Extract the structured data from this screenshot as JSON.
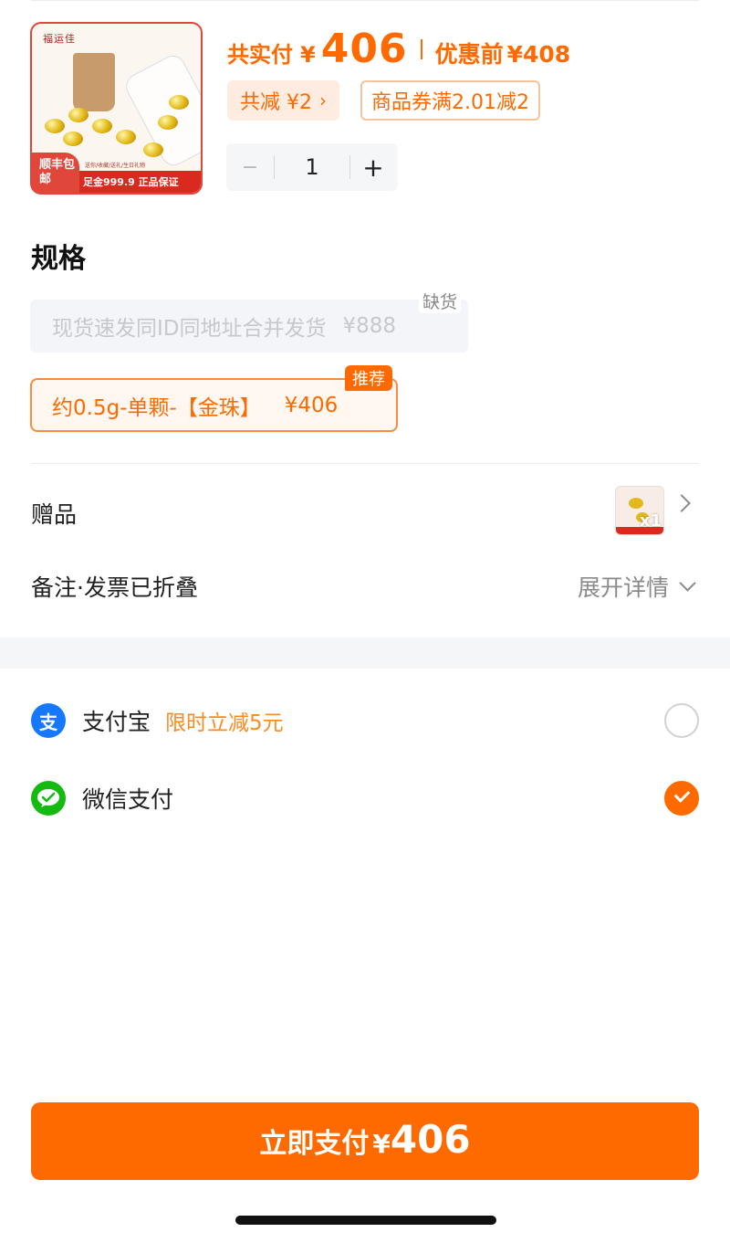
{
  "product": {
    "brand": "福运佳",
    "badge_sf": "顺丰包邮",
    "guarantee": "足金999.9 正品保证",
    "tagline": "送你/收藏/送礼/生日礼物"
  },
  "price": {
    "paid_label": "共实付",
    "currency": "¥",
    "paid_amount": "406",
    "before_label": "优惠前",
    "before_amount": "¥408"
  },
  "discount": {
    "total_label": "共减 ¥2",
    "coupon_label": "商品券满2.01减2"
  },
  "quantity": {
    "minus": "−",
    "value": "1",
    "plus": "+"
  },
  "spec": {
    "title": "规格",
    "options": [
      {
        "label": "现货速发同ID同地址合并发货",
        "price": "¥888",
        "status": "缺货"
      },
      {
        "label": "约0.5g-单颗-【金珠】",
        "price": "¥406",
        "tag": "推荐"
      }
    ]
  },
  "gift": {
    "label": "赠品",
    "thumb_badge": "x1"
  },
  "note": {
    "label": "备注·发票已折叠",
    "expand_label": "展开详情"
  },
  "payment": {
    "methods": [
      {
        "name": "支付宝",
        "icon": "alipay-icon",
        "glyph": "支",
        "promo": "限时立减5元",
        "selected": false
      },
      {
        "name": "微信支付",
        "icon": "wechat-icon",
        "glyph": "",
        "promo": "",
        "selected": true
      }
    ]
  },
  "pay_button": {
    "label": "立即支付",
    "currency": "¥",
    "amount": "406"
  },
  "colors": {
    "accent": "#ff6a00",
    "alipay": "#1677ff",
    "wechat": "#15ba11"
  }
}
